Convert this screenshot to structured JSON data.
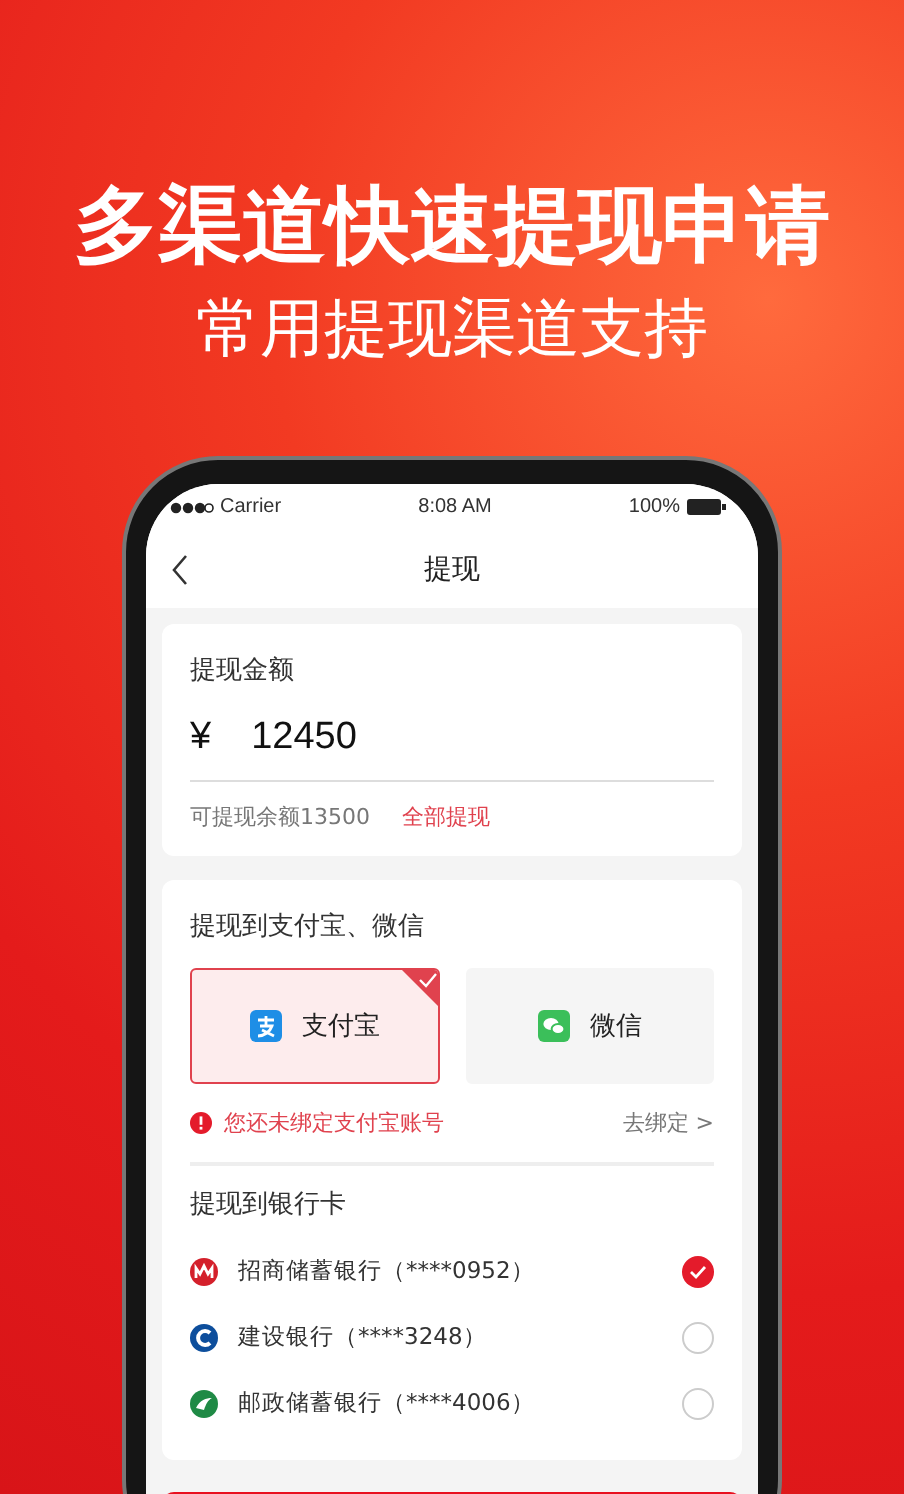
{
  "headline": {
    "title": "多渠道快速提现申请",
    "subtitle": "常用提现渠道支持"
  },
  "status_bar": {
    "carrier": "Carrier",
    "time": "8:08 AM",
    "battery": "100%"
  },
  "nav": {
    "title": "提现"
  },
  "amount_card": {
    "label": "提现金额",
    "currency": "¥",
    "amount": "12450",
    "balance": "可提现余额13500",
    "withdraw_all": "全部提现"
  },
  "wallet_section": {
    "title": "提现到支付宝、微信",
    "options": [
      {
        "kind": "alipay",
        "label": "支付宝",
        "selected": true
      },
      {
        "kind": "wechat",
        "label": "微信",
        "selected": false
      }
    ],
    "warning": "您还未绑定支付宝账号",
    "bind_link": "去绑定 >"
  },
  "bank_section": {
    "title": "提现到银行卡",
    "banks": [
      {
        "kind": "merchants",
        "name": "招商储蓄银行（****0952）",
        "selected": true
      },
      {
        "kind": "construction",
        "name": "建设银行（****3248）",
        "selected": false
      },
      {
        "kind": "postal",
        "name": "邮政储蓄银行（****4006）",
        "selected": false
      }
    ]
  }
}
